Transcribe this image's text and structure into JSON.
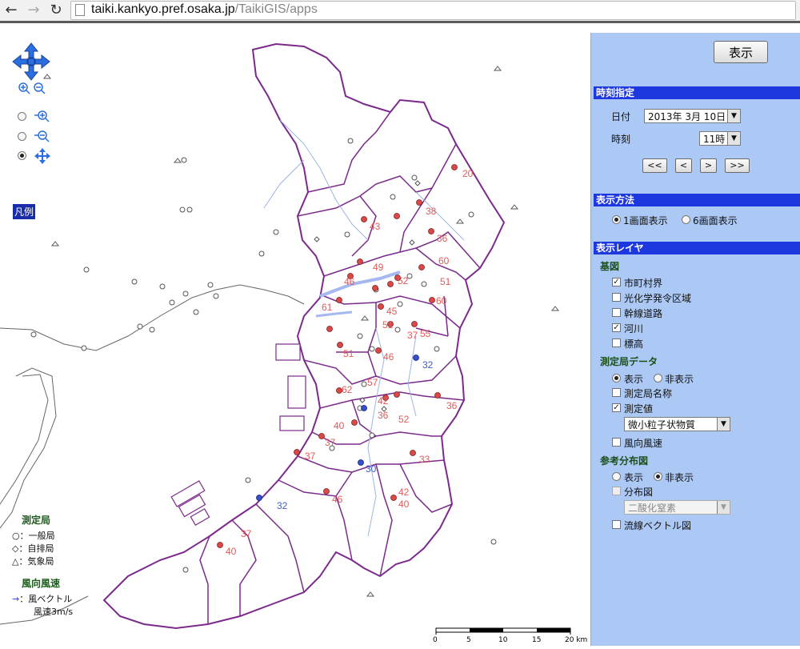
{
  "browser": {
    "back_icon": "arrow-left-icon",
    "forward_icon": "arrow-right-icon",
    "reload_icon": "reload-icon",
    "url_host": "taiki.kankyo.pref.osaka.jp",
    "url_path": "/TaikiGIS/apps"
  },
  "map": {
    "legend_button": "凡例",
    "stations_title": "測定局",
    "station_types": [
      {
        "symbol": "○",
        "label": "：一般局"
      },
      {
        "symbol": "◇",
        "label": "：自排局"
      },
      {
        "symbol": "△",
        "label": "：気象局"
      }
    ],
    "wind_title": "風向風速",
    "wind_vector_label": "：風ベクトル",
    "wind_speed_label": "風速3m/s",
    "scale_labels": [
      "0",
      "5",
      "10",
      "15",
      "20 km"
    ],
    "values": [
      {
        "v": "20",
        "c": "#e05a5a"
      },
      {
        "v": "38",
        "c": "#e05a5a"
      },
      {
        "v": "43",
        "c": "#e05a5a"
      },
      {
        "v": "36",
        "c": "#e05a5a"
      },
      {
        "v": "60",
        "c": "#e05a5a"
      },
      {
        "v": "49",
        "c": "#e05a5a"
      },
      {
        "v": "46",
        "c": "#e05a5a"
      },
      {
        "v": "52",
        "c": "#e05a5a"
      },
      {
        "v": "51",
        "c": "#e05a5a"
      },
      {
        "v": "61",
        "c": "#e05a5a"
      },
      {
        "v": "60",
        "c": "#e05a5a"
      },
      {
        "v": "45",
        "c": "#e05a5a"
      },
      {
        "v": "51",
        "c": "#e05a5a"
      },
      {
        "v": "55",
        "c": "#e05a5a"
      },
      {
        "v": "37",
        "c": "#e05a5a"
      },
      {
        "v": "51",
        "c": "#e05a5a"
      },
      {
        "v": "46",
        "c": "#e05a5a"
      },
      {
        "v": "32",
        "c": "#3a5ec8"
      },
      {
        "v": "62",
        "c": "#e05a5a"
      },
      {
        "v": "57",
        "c": "#e05a5a"
      },
      {
        "v": "42",
        "c": "#e05a5a"
      },
      {
        "v": "52",
        "c": "#e05a5a"
      },
      {
        "v": "36",
        "c": "#e05a5a"
      },
      {
        "v": "36",
        "c": "#e05a5a"
      },
      {
        "v": "40",
        "c": "#e05a5a"
      },
      {
        "v": "37",
        "c": "#e05a5a"
      },
      {
        "v": "37",
        "c": "#e05a5a"
      },
      {
        "v": "30",
        "c": "#3a5ec8"
      },
      {
        "v": "33",
        "c": "#e05a5a"
      },
      {
        "v": "32",
        "c": "#3a5ec8"
      },
      {
        "v": "46",
        "c": "#e05a5a"
      },
      {
        "v": "42",
        "c": "#e05a5a"
      },
      {
        "v": "40",
        "c": "#e05a5a"
      },
      {
        "v": "37",
        "c": "#e05a5a"
      },
      {
        "v": "40",
        "c": "#e05a5a"
      }
    ]
  },
  "panel": {
    "show_button": "表示",
    "time_section": "時刻指定",
    "date_label": "日付",
    "date_value": "2013年  3月  10日",
    "time_label": "時刻",
    "time_value": "11時",
    "nav_buttons": [
      "<<",
      "<",
      ">",
      ">>"
    ],
    "display_section": "表示方法",
    "single_view": "1画面表示",
    "six_view": "6画面表示",
    "layer_section": "表示レイヤ",
    "base_map": "基図",
    "base_layers": [
      {
        "label": "市町村界",
        "checked": true
      },
      {
        "label": "光化学発令区域",
        "checked": false
      },
      {
        "label": "幹線道路",
        "checked": false
      },
      {
        "label": "河川",
        "checked": true
      },
      {
        "label": "標高",
        "checked": false
      }
    ],
    "station_data": "測定局データ",
    "show": "表示",
    "hide": "非表示",
    "station_name": "測定局名称",
    "measured_value": "測定値",
    "pollutant_value": "微小粒子状物質",
    "wind": "風向風速",
    "reference_map": "参考分布図",
    "ref_show": "表示",
    "ref_hide": "非表示",
    "distribution_map": "分布図",
    "distribution_value": "二酸化窒素",
    "streamline": "流線ベクトル図"
  }
}
